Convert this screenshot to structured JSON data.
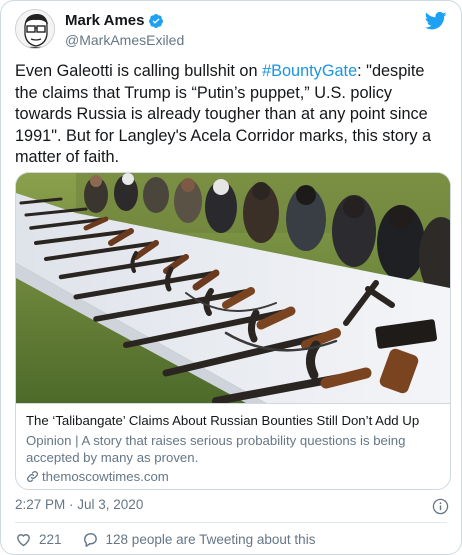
{
  "author": {
    "display_name": "Mark Ames",
    "handle": "@MarkAmesExiled",
    "verified": true
  },
  "tweet": {
    "text_before": "Even Galeotti is calling bullshit on ",
    "hashtag": "#BountyGate",
    "text_after": ": \"despite the claims that Trump is “Putin’s puppet,” U.S. policy towards Russia is already tougher than at any point since 1991\". But for Langley's Acela Corridor marks, this story a matter of faith."
  },
  "card": {
    "title": "The ‘Talibangate’ Claims About Russian Bounties Still Don’t Add Up",
    "description": "Opinion | A story that raises serious probability questions is being accepted by many as proven.",
    "domain": "themoscowtimes.com"
  },
  "meta": {
    "timestamp": "2:27 PM · Jul 3, 2020"
  },
  "actions": {
    "likes": "221",
    "conversation": "128 people are Tweeting about this"
  },
  "colors": {
    "link": "#1b95e0",
    "secondary_text": "#657786",
    "twitter_blue": "#1da1f2"
  },
  "icons": [
    "verified-icon",
    "twitter-bird-icon",
    "link-icon",
    "info-icon",
    "heart-icon",
    "reply-icon"
  ]
}
